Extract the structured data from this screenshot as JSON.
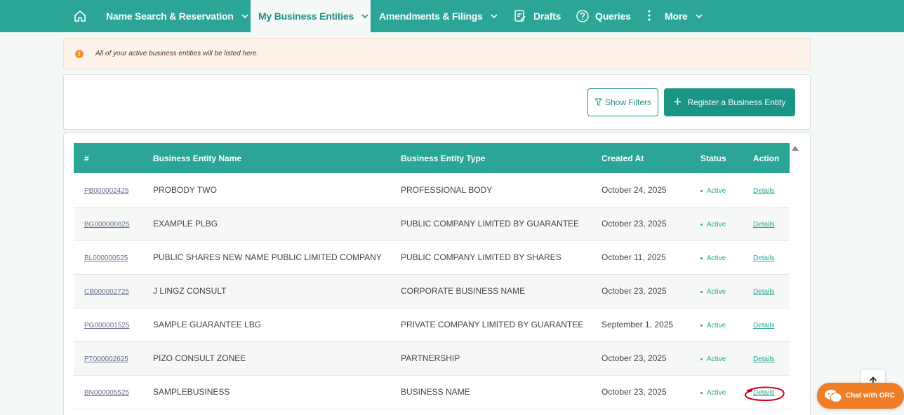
{
  "nav": {
    "home_icon": "home-icon",
    "items": [
      {
        "label": "Name Search & Reservation",
        "has_chevron": true
      },
      {
        "label": "My Business Entities",
        "has_chevron": true,
        "active": true
      },
      {
        "label": "Amendments & Filings",
        "has_chevron": true
      },
      {
        "label": "Drafts",
        "icon": "drafts-icon"
      },
      {
        "label": "Queries",
        "icon": "question-circle-icon"
      },
      {
        "label": "More",
        "icon": "vertical-dots-icon",
        "has_chevron": true
      }
    ]
  },
  "alert": {
    "icon": "warning-circle-icon",
    "text": "All of your active business entities will be listed here."
  },
  "toolbar": {
    "filter_label": "Show Filters",
    "register_label": "Register a Business Entity"
  },
  "table": {
    "columns": [
      "#",
      "Business Entity Name",
      "Business Entity Type",
      "Created At",
      "Status",
      "Action"
    ],
    "rows": [
      {
        "id": "PB000002425",
        "name": "PROBODY TWO",
        "type": "PROFESSIONAL BODY",
        "created": "October 24, 2025",
        "status": "Active",
        "action": "Details"
      },
      {
        "id": "BG000000825",
        "name": "EXAMPLE PLBG",
        "type": "PUBLIC COMPANY LIMITED BY GUARANTEE",
        "created": "October 23, 2025",
        "status": "Active",
        "action": "Details"
      },
      {
        "id": "BL000000525",
        "name": "PUBLIC SHARES NEW NAME PUBLIC LIMITED COMPANY",
        "type": "PUBLIC COMPANY LIMITED BY SHARES",
        "created": "October 11, 2025",
        "status": "Active",
        "action": "Details"
      },
      {
        "id": "CB000002725",
        "name": "J LINGZ CONSULT",
        "type": "CORPORATE BUSINESS NAME",
        "created": "October 23, 2025",
        "status": "Active",
        "action": "Details"
      },
      {
        "id": "PG000001525",
        "name": "SAMPLE GUARANTEE LBG",
        "type": "PRIVATE COMPANY LIMITED BY GUARANTEE",
        "created": "September 1, 2025",
        "status": "Active",
        "action": "Details"
      },
      {
        "id": "PT000002625",
        "name": "PIZO CONSULT ZONEE",
        "type": "PARTNERSHIP",
        "created": "October 23, 2025",
        "status": "Active",
        "action": "Details"
      },
      {
        "id": "BN000005525",
        "name": "SAMPLEBUSINESS",
        "type": "BUSINESS NAME",
        "created": "October 23, 2025",
        "status": "Active",
        "action": "Details"
      }
    ]
  },
  "chat": {
    "label": "Chat with ORC",
    "icon": "chat-bubbles-icon"
  },
  "colors": {
    "primary": "#2aa596",
    "accent_orange": "#f07e27",
    "annotation_red": "#d0021b"
  }
}
